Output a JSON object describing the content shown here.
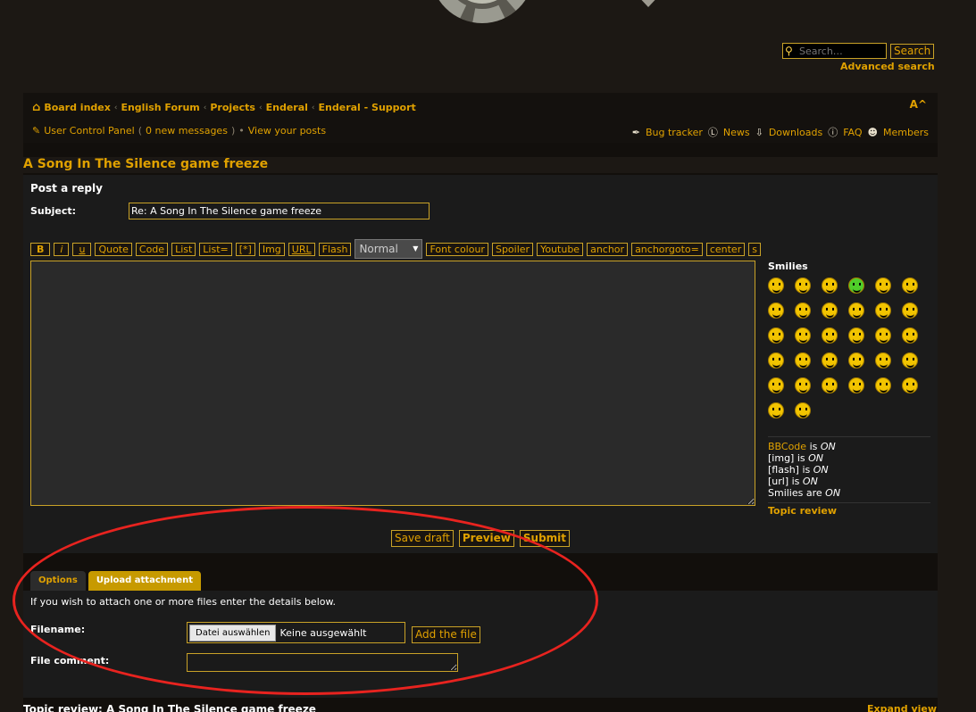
{
  "header": {
    "search_placeholder": "Search…",
    "search_button": "Search",
    "advanced_search": "Advanced search",
    "font_toggle": "A^"
  },
  "breadcrumbs": [
    "Board index",
    "English Forum",
    "Projects",
    "Enderal",
    "Enderal - Support"
  ],
  "user_bar": {
    "ucp": "User Control Panel",
    "messages_open": "(",
    "messages": "0 new messages",
    "messages_close": ")",
    "bullet": "•",
    "view_posts": "View your posts"
  },
  "right_links": [
    "Bug tracker",
    "News",
    "Downloads",
    "FAQ",
    "Members"
  ],
  "topic_title": "A Song In The Silence game freeze",
  "post": {
    "heading": "Post a reply",
    "subject_label": "Subject:",
    "subject_value": "Re: A Song In The Silence game freeze",
    "toolbar": [
      "B",
      "i",
      "u",
      "Quote",
      "Code",
      "List",
      "List=",
      "[*]",
      "Img",
      "URL",
      "Flash"
    ],
    "font_size": "Normal",
    "toolbar2": [
      "Font colour",
      "Spoiler",
      "Youtube",
      "anchor",
      "anchorgoto=",
      "center",
      "s"
    ]
  },
  "smilies": {
    "title": "Smilies",
    "count": 32
  },
  "bbcode": {
    "bbcode": "BBCode",
    "bbcode_is": "is",
    "on": "ON",
    "img": "[img] is",
    "flash": "[flash] is",
    "url": "[url] is",
    "smilies": "Smilies are"
  },
  "topic_review_link": "Topic review",
  "buttons": {
    "save_draft": "Save draft",
    "preview": "Preview",
    "submit": "Submit"
  },
  "tabs": [
    "Options",
    "Upload attachment"
  ],
  "attachment": {
    "message": "If you wish to attach one or more files enter the details below.",
    "filename_label": "Filename:",
    "choose_button": "Datei auswählen",
    "no_file": "Keine ausgewählt",
    "add_file": "Add the file",
    "comment_label": "File comment:"
  },
  "footer": {
    "topic_review": "Topic review: A Song In The Silence game freeze",
    "expand": "Expand view"
  },
  "colors": {
    "accent": "#e0a100",
    "annotation": "#e8231f"
  }
}
